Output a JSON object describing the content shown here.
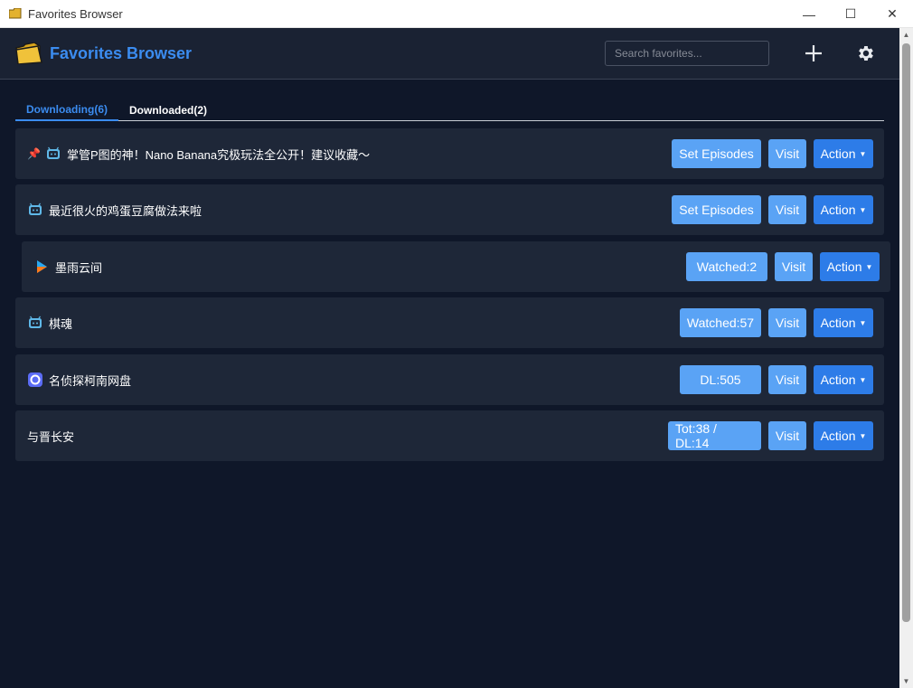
{
  "window": {
    "title": "Favorites Browser",
    "minimize": "—",
    "maximize": "☐",
    "close": "✕"
  },
  "header": {
    "brand": "Favorites Browser",
    "search_placeholder": "Search favorites...",
    "add_icon": "plus-icon",
    "settings_icon": "gear-icon"
  },
  "tabs": [
    {
      "label": "Downloading(6)",
      "active": true
    },
    {
      "label": "Downloaded(2)",
      "active": false
    }
  ],
  "items": [
    {
      "name": "掌管P图的神！Nano Banana究极玩法全公开！建议收藏～",
      "pinned": true,
      "icon": "bilibili-icon",
      "status": "Set Episodes",
      "visit": "Visit",
      "action": "Action"
    },
    {
      "name": "最近很火的鸡蛋豆腐做法来啦",
      "pinned": false,
      "icon": "bilibili-icon",
      "status": "Set Episodes",
      "visit": "Visit",
      "action": "Action"
    },
    {
      "name": "墨雨云间",
      "pinned": false,
      "icon": "youku-icon",
      "status": "Watched:2",
      "visit": "Visit",
      "action": "Action"
    },
    {
      "name": "棋魂",
      "pinned": false,
      "icon": "bilibili-icon",
      "status": "Watched:57",
      "visit": "Visit",
      "action": "Action"
    },
    {
      "name": "名侦探柯南网盘",
      "pinned": false,
      "icon": "netdisk-icon",
      "status": "DL:505",
      "visit": "Visit",
      "action": "Action"
    },
    {
      "name": "与晋长安",
      "pinned": false,
      "icon": "",
      "status": "Tot:38 / DL:14",
      "visit": "Visit",
      "action": "Action"
    }
  ],
  "colors": {
    "background": "#0f1729",
    "card": "#1e2738",
    "accent": "#3b8cf0",
    "button_light": "#5aa3f5",
    "button_primary": "#2d7ce8"
  }
}
